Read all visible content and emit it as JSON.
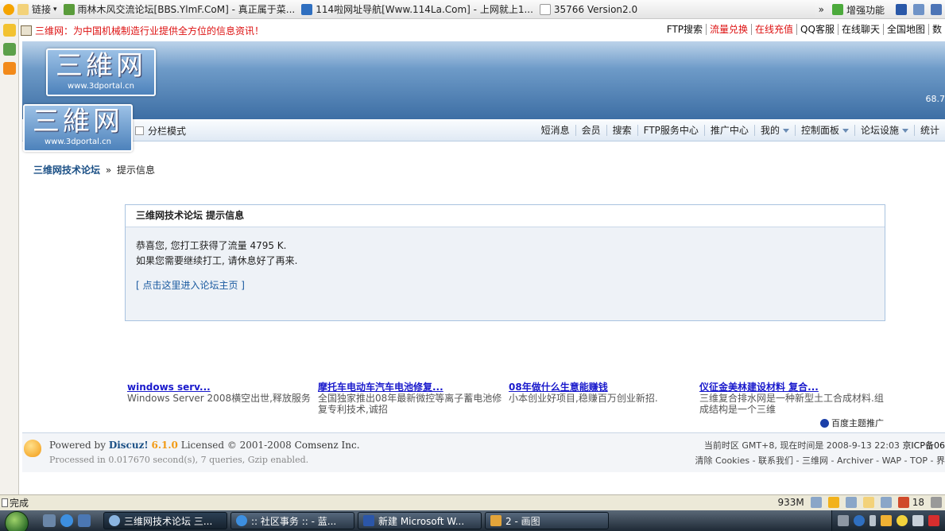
{
  "browser": {
    "links_label": "链接",
    "links": [
      "雨林木风交流论坛[BBS.YlmF.CoM] - 真正属于菜...",
      "114啦网址导航[Www.114La.Com] - 上网就上1...",
      "35766 Version2.0"
    ],
    "chevron": "»",
    "enhance_label": "增强功能",
    "status_done": "完成",
    "status_memory": "933M",
    "status_count": "18"
  },
  "infobar": {
    "site_message": "三维网：为中国机械制造行业提供全方位的信息资讯！",
    "links": [
      {
        "label": "FTP搜索",
        "red": false
      },
      {
        "label": "流量兑换",
        "red": true
      },
      {
        "label": "在线充值",
        "red": true
      },
      {
        "label": "QQ客服",
        "red": false
      },
      {
        "label": "在线聊天",
        "red": false
      },
      {
        "label": "全国地图",
        "red": false
      },
      {
        "label": "数",
        "red": false
      }
    ]
  },
  "header": {
    "logo_text": "三維网",
    "logo_url": "www.3dportal.cn",
    "ip_text": "68.7"
  },
  "nav": {
    "mode_label": "分栏模式",
    "items": [
      {
        "label": "短消息",
        "dropdown": false
      },
      {
        "label": "会员",
        "dropdown": false
      },
      {
        "label": "搜索",
        "dropdown": false
      },
      {
        "label": "FTP服务中心",
        "dropdown": false
      },
      {
        "label": "推广中心",
        "dropdown": false
      },
      {
        "label": "我的",
        "dropdown": true
      },
      {
        "label": "控制面板",
        "dropdown": true
      },
      {
        "label": "论坛设施",
        "dropdown": true
      },
      {
        "label": "统计",
        "dropdown": false
      }
    ]
  },
  "breadcrumb": {
    "home": "三维网技术论坛",
    "separator": "»",
    "current": "提示信息"
  },
  "message": {
    "title": "三维网技术论坛  提示信息",
    "line1": "恭喜您, 您打工获得了流量  4795 K.",
    "line2": "如果您需要继续打工, 请休息好了再来.",
    "link": "[ 点击这里进入论坛主页 ]"
  },
  "ads": [
    {
      "title": "windows serv...",
      "desc": "Windows Server 2008横空出世,释放服务"
    },
    {
      "title": "摩托车电动车汽车电池修复...",
      "desc": "全国独家推出08年最新微控等离子蓄电池修复专利技术,诚招"
    },
    {
      "title": "08年做什么生意能赚钱",
      "desc": "小本创业好项目,稳赚百万创业新招."
    },
    {
      "title": "仪征金美林建设材料  复合...",
      "desc": "三维复合排水网是一种新型土工合成材料.组成结构是一个三维"
    }
  ],
  "baidu_label": "百度主题推广",
  "footer": {
    "powered_prefix": "Powered by",
    "brand": "Discuz!",
    "version": "6.1.0",
    "licensed": "Licensed © 2001-2008",
    "company": "Comsenz Inc.",
    "processed": "Processed in 0.017670 second(s), 7 queries, Gzip enabled.",
    "timezone": "当前时区  GMT+8, 现在时间是  2008-9-13 22:03",
    "icp": "京ICP备06",
    "links": "清除  Cookies - 联系我们  - 三维网 - Archiver - WAP - TOP - 界"
  },
  "taskbar": {
    "tasks": [
      {
        "label": "三维网技术论坛 三...",
        "active": true
      },
      {
        "label": ":: 社区事务 :: - 蓝...",
        "active": false
      },
      {
        "label": "新建 Microsoft W...",
        "active": false
      },
      {
        "label": "2 - 画图",
        "active": false
      }
    ]
  }
}
